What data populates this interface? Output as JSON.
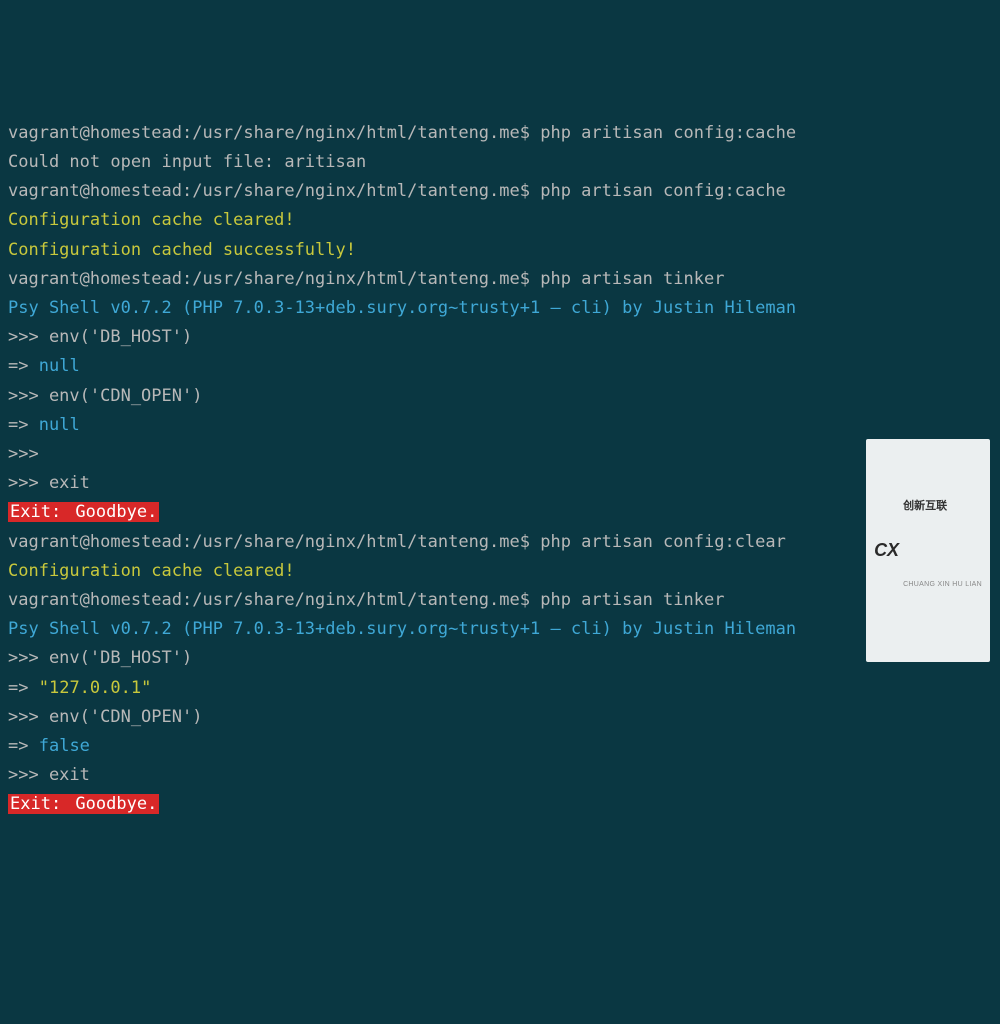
{
  "prompt": "vagrant@homestead:/usr/share/nginx/html/tanteng.me$",
  "lines": {
    "l1_cmd": "php aritisan config:cache",
    "l2_err": "Could not open input file: aritisan",
    "l3_cmd": "php artisan config:cache",
    "l4_ok": "Configuration cache cleared!",
    "l5_ok": "Configuration cached successfully!",
    "l6_cmd": "php artisan tinker",
    "l7_psy": "Psy Shell v0.7.2 (PHP 7.0.3-13+deb.sury.org~trusty+1 — cli) by Justin Hileman",
    "l8_repl": ">>> env('DB_HOST')",
    "l9_arrow": "=>",
    "l9_val": "null",
    "l10_repl": ">>> env('CDN_OPEN')",
    "l11_arrow": "=>",
    "l11_val": "null",
    "l12_repl": ">>>",
    "l13_repl": ">>> exit",
    "l14_exit": "Exit:",
    "l14_bye": " Goodbye.",
    "l15_cmd": "php artisan config:clear",
    "l16_ok": "Configuration cache cleared!",
    "l17_cmd": "php artisan tinker",
    "l18_psy": "Psy Shell v0.7.2 (PHP 7.0.3-13+deb.sury.org~trusty+1 — cli) by Justin Hileman",
    "l19_repl": ">>> env('DB_HOST')",
    "l20_arrow": "=>",
    "l20_val": "\"127.0.0.1\"",
    "l21_repl": ">>> env('CDN_OPEN')",
    "l22_arrow": "=>",
    "l22_val": "false",
    "l23_repl": ">>> exit",
    "l24_exit": "Exit:",
    "l24_bye": " Goodbye."
  },
  "watermark": {
    "logo": "CX",
    "brand": "创新互联",
    "sub": "CHUANG XIN HU LIAN"
  }
}
